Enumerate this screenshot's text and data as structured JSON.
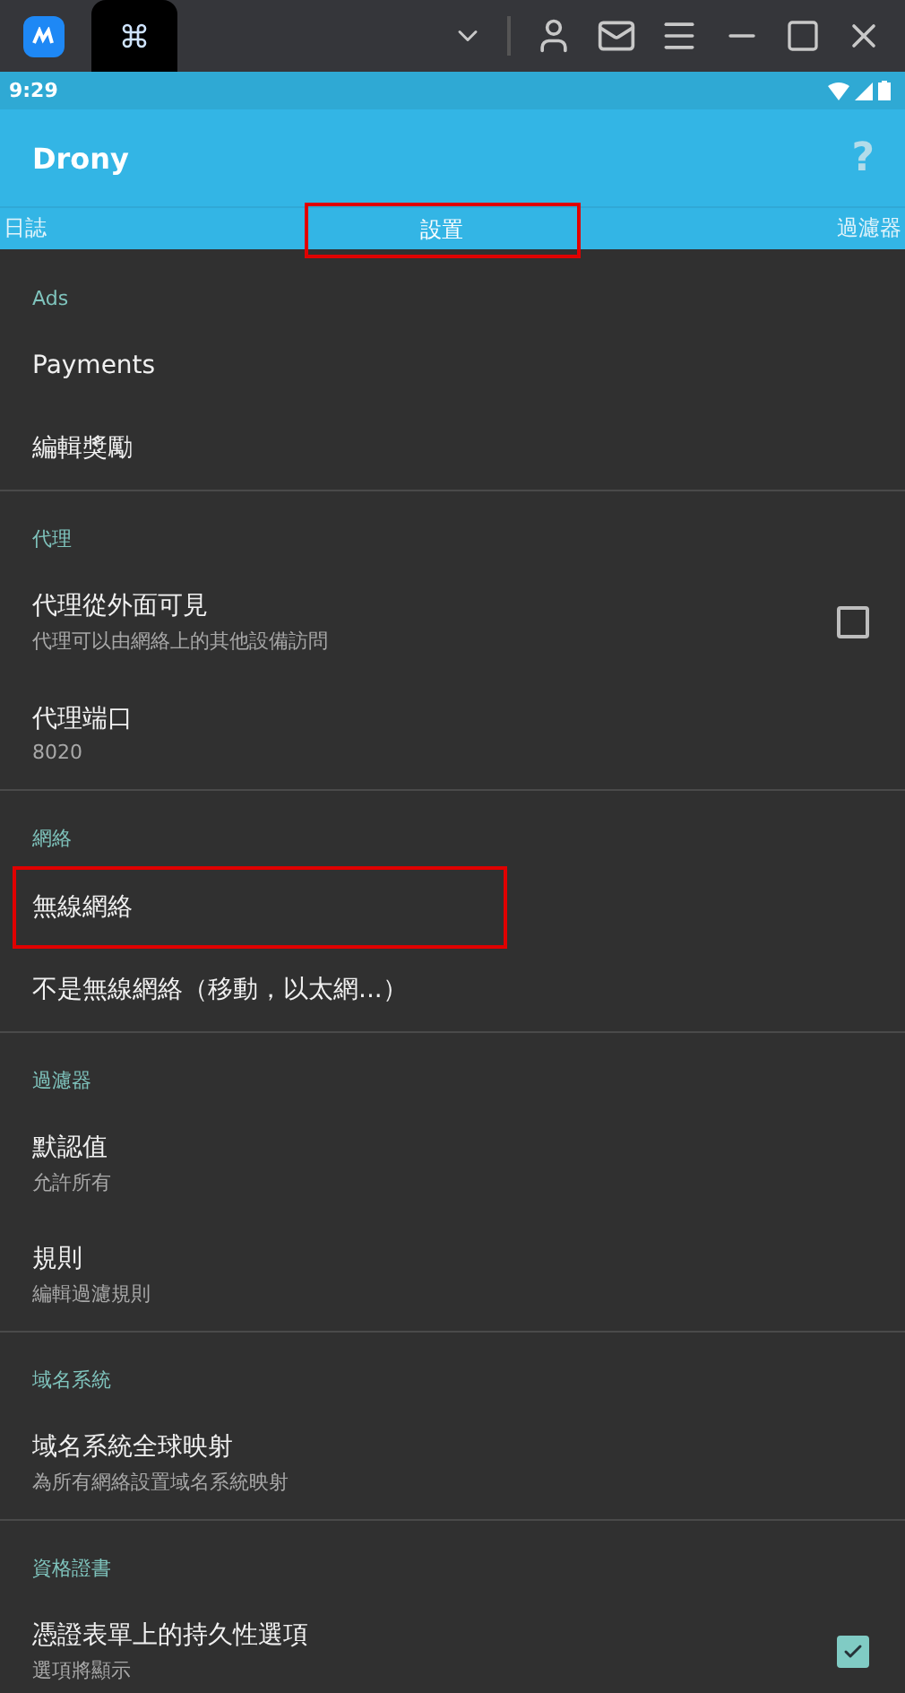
{
  "status_bar": {
    "time": "9:29"
  },
  "app_bar": {
    "title": "Drony",
    "help": "?"
  },
  "tabs": [
    {
      "label": "日誌",
      "selected": false,
      "highlighted": false
    },
    {
      "label": "設置",
      "selected": true,
      "highlighted": true
    },
    {
      "label": "過濾器",
      "selected": false,
      "highlighted": false
    }
  ],
  "sections": [
    {
      "header": "Ads",
      "items": [
        {
          "title": "Payments",
          "highlighted": false
        },
        {
          "title": "編輯獎勵",
          "highlighted": false
        }
      ]
    },
    {
      "header": "代理",
      "items": [
        {
          "title": "代理從外面可見",
          "subtitle": "代理可以由網絡上的其他設備訪問",
          "kind": "checkbox",
          "checked": false,
          "highlighted": false
        },
        {
          "title": "代理端口",
          "subtitle": "8020",
          "highlighted": false
        }
      ]
    },
    {
      "header": "網絡",
      "items": [
        {
          "title": "無線網絡",
          "highlighted": true
        },
        {
          "title": "不是無線網絡（移動，以太網...）",
          "highlighted": false
        }
      ]
    },
    {
      "header": "過濾器",
      "items": [
        {
          "title": "默認值",
          "subtitle": "允許所有",
          "highlighted": false
        },
        {
          "title": "規則",
          "subtitle": "編輯過濾規則",
          "highlighted": false
        }
      ]
    },
    {
      "header": "域名系統",
      "items": [
        {
          "title": "域名系統全球映射",
          "subtitle": "為所有網絡設置域名系統映射",
          "highlighted": false
        }
      ]
    },
    {
      "header": "資格證書",
      "items": [
        {
          "title": "憑證表單上的持久性選項",
          "subtitle": "選項將顯示",
          "kind": "checkbox",
          "checked": true,
          "highlighted": false
        }
      ]
    }
  ]
}
